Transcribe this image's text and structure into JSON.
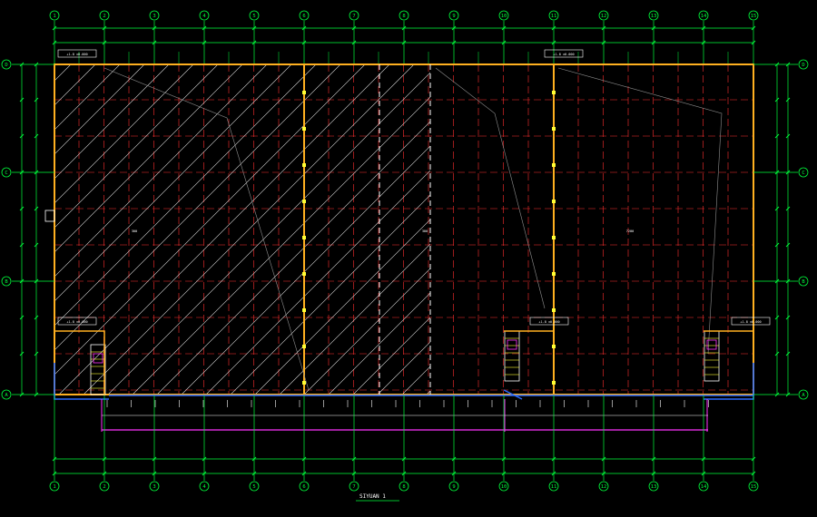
{
  "drawing": {
    "title": "SIYUAN 1",
    "background": "#000000",
    "colors": {
      "wall": "#ffb020",
      "grid": "#ff3030",
      "axis": "#00ff3c",
      "hatch": "#e8e8e8",
      "dim": "#00ff3c",
      "magenta": "#ff33ff",
      "blue": "#2a6bff",
      "yellow": "#ffff33",
      "white": "#ffffff",
      "gray": "#909090"
    },
    "column_axes": [
      "1",
      "2",
      "3",
      "4",
      "5",
      "6",
      "7",
      "8",
      "9",
      "10",
      "11",
      "12",
      "13",
      "14",
      "15"
    ],
    "row_axes": [
      "D",
      "C",
      "B",
      "A"
    ],
    "zone_labels": [
      "300",
      "300",
      "7200"
    ],
    "level_tags": [
      "+1.8 ±0.000",
      "+1.8 ±0.000",
      "+1.8 ±0.000",
      "+1.8 ±0.000",
      "+1.8 ±0.000"
    ],
    "icons": [
      "column-axis-bubble-icon",
      "row-axis-bubble-icon",
      "elevation-marker-icon",
      "stair-icon"
    ]
  }
}
